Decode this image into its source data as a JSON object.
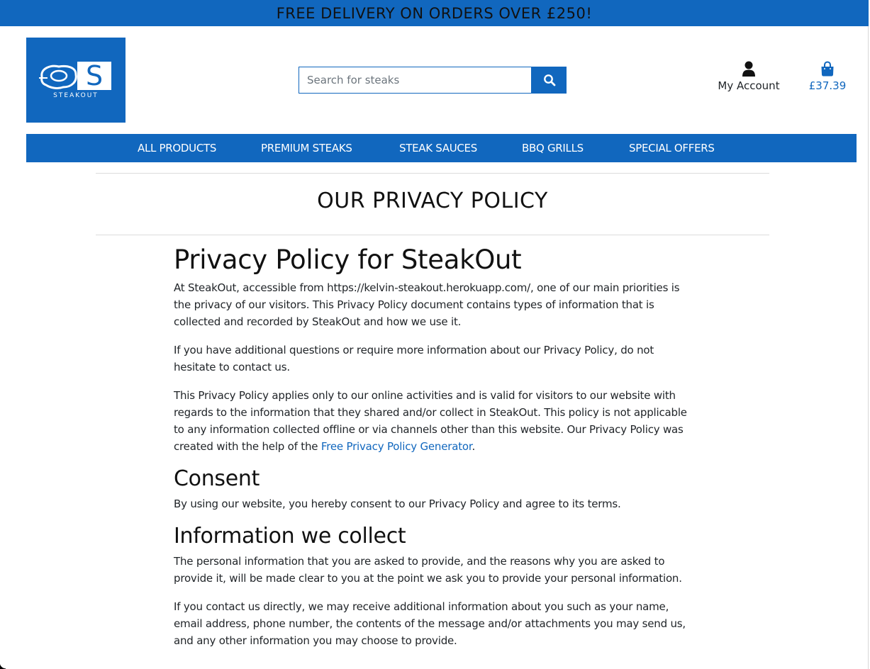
{
  "banner": {
    "text": "FREE DELIVERY ON ORDERS OVER £250!"
  },
  "logo": {
    "text": "STEAKOUT"
  },
  "search": {
    "placeholder": "Search for steaks"
  },
  "account": {
    "label": "My Account"
  },
  "cart": {
    "amount": "£37.39"
  },
  "nav": {
    "items": [
      "ALL PRODUCTS",
      "PREMIUM STEAKS",
      "STEAK SAUCES",
      "BBQ GRILLS",
      "SPECIAL OFFERS"
    ]
  },
  "page": {
    "title": "OUR PRIVACY POLICY"
  },
  "policy": {
    "heading": "Privacy Policy for SteakOut",
    "p1": "At SteakOut, accessible from https://kelvin-steakout.herokuapp.com/, one of our main priorities is the privacy of our visitors. This Privacy Policy document contains types of information that is collected and recorded by SteakOut and how we use it.",
    "p2": "If you have additional questions or require more information about our Privacy Policy, do not hesitate to contact us.",
    "p3_before": "This Privacy Policy applies only to our online activities and is valid for visitors to our website with regards to the information that they shared and/or collect in SteakOut. This policy is not applicable to any information collected offline or via channels other than this website. Our Privacy Policy was created with the help of the ",
    "p3_link": "Free Privacy Policy Generator",
    "p3_after": ".",
    "consent_heading": "Consent",
    "consent_text": "By using our website, you hereby consent to our Privacy Policy and agree to its terms.",
    "info_heading": "Information we collect",
    "info_p1": "The personal information that you are asked to provide, and the reasons why you are asked to provide it, will be made clear to you at the point we ask you to provide your personal information.",
    "info_p2": "If you contact us directly, we may receive additional information about you such as your name, email address, phone number, the contents of the message and/or attachments you may send us, and any other information you may choose to provide."
  },
  "icons": {
    "search": "search-icon",
    "account": "user-icon",
    "cart": "shopping-bag-icon"
  },
  "colors": {
    "brand": "#1167be"
  }
}
